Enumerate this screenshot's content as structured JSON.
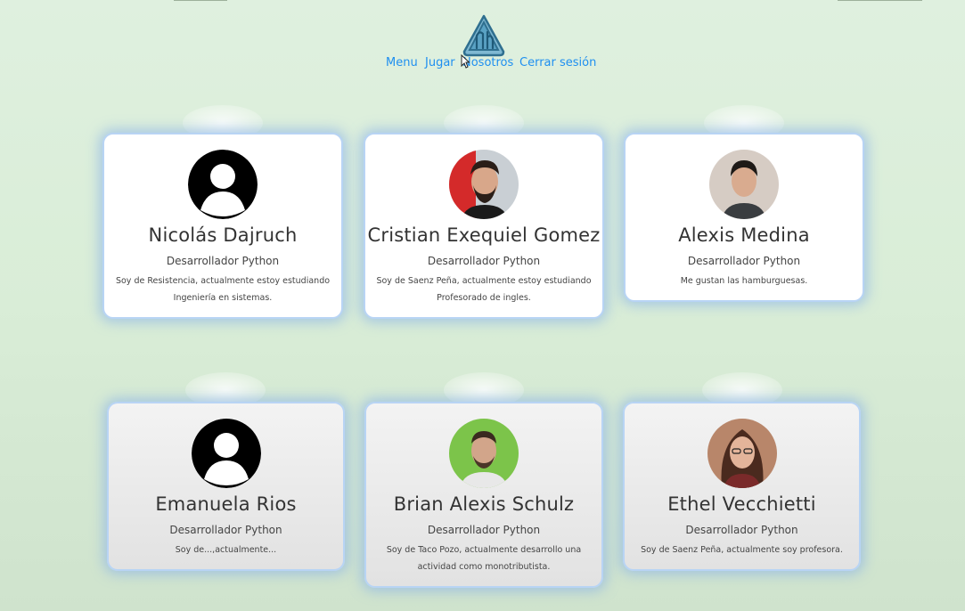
{
  "nav": {
    "items": [
      "Menu",
      "Jugar",
      "Nosotros",
      "Cerrar sesión"
    ]
  },
  "colors": {
    "nav_link": "#1e8ff0",
    "logo": "#3e87a8",
    "card_glow": "#7daaeb",
    "background": "#dcefd9"
  },
  "icons": {
    "logo": "logo-icon",
    "cursor": "mouse-cursor-icon",
    "default_avatar": "user-silhouette-icon"
  },
  "cards": [
    {
      "name": "Nicolás Dajruch",
      "role": "Desarrollador Python",
      "description": "Soy de Resistencia, actualmente estoy estudiando Ingeniería en sistemas.",
      "avatar": "default"
    },
    {
      "name": "Cristian Exequiel Gomez",
      "role": "Desarrollador Python",
      "description": "Soy de Saenz Peña, actualmente estoy estudiando Profesorado de ingles.",
      "avatar": "photo"
    },
    {
      "name": "Alexis Medina",
      "role": "Desarrollador Python",
      "description": "Me gustan las hamburguesas.",
      "avatar": "photo"
    },
    {
      "name": "Emanuela Rios",
      "role": "Desarrollador Python",
      "description": "Soy de...,actualmente...",
      "avatar": "default"
    },
    {
      "name": "Brian Alexis Schulz",
      "role": "Desarrollador Python",
      "description": "Soy de Taco Pozo, actualmente desarrollo una actividad como monotributista.",
      "avatar": "photo"
    },
    {
      "name": "Ethel Vecchietti",
      "role": "Desarrollador Python",
      "description": "Soy de Saenz Peña, actualmente soy profesora.",
      "avatar": "photo"
    }
  ]
}
